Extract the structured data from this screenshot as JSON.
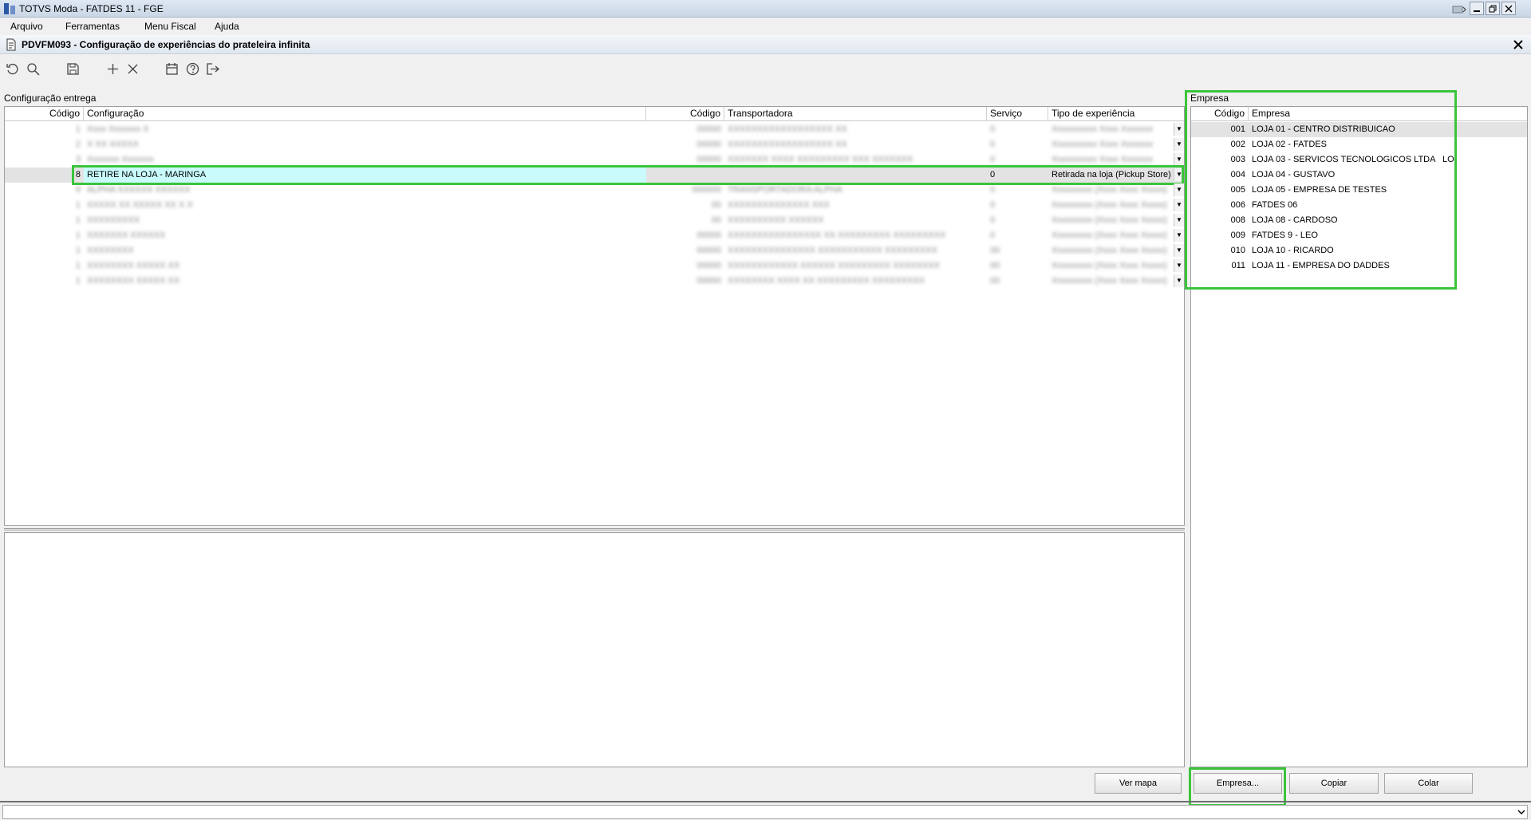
{
  "window": {
    "title": "TOTVS Moda - FATDES 11 - FGE"
  },
  "menu": [
    {
      "label": "Arquivo"
    },
    {
      "label": "Ferramentas"
    },
    {
      "label": "Menu Fiscal"
    },
    {
      "label": "Ajuda"
    }
  ],
  "form": {
    "title": "PDVFM093 - Configuração de experiências do prateleira infinita"
  },
  "toolbar": {
    "icons": [
      "refresh-icon",
      "search-icon",
      "save-icon",
      "add-icon",
      "delete-icon",
      "calendar-icon",
      "help-icon",
      "exit-icon"
    ]
  },
  "config": {
    "section_label": "Configuração entrega",
    "headers": {
      "codigo": "Código",
      "configuracao": "Configuração",
      "codigo2": "Código",
      "transportadora": "Transportadora",
      "servico": "Serviço",
      "tipo": "Tipo de experiência"
    },
    "rows": [
      {
        "codigo": "1",
        "configuracao": "Xxxx Xxxxxxx X",
        "codigo2": "00000",
        "transportadora": "XXXXXXXXXXXXXXXXXX XX",
        "servico": "0",
        "tipo": "Xxxxxxxxxx Xxxx Xxxxxxx",
        "blurred": true,
        "selected": false
      },
      {
        "codigo": "2",
        "configuracao": "X XX XXXXX",
        "codigo2": "00000",
        "transportadora": "XXXXXXXXXXXXXXXXXX XX",
        "servico": "0",
        "tipo": "Xxxxxxxxxx Xxxx Xxxxxxx",
        "blurred": true,
        "selected": false
      },
      {
        "codigo": "3",
        "configuracao": "Xxxxxxx Xxxxxxx",
        "codigo2": "00000",
        "transportadora": "XXXXXXX XXXX XXXXXXXXX XXX XXXXXXX",
        "servico": "0",
        "tipo": "Xxxxxxxxxx Xxxx Xxxxxxx",
        "blurred": true,
        "selected": false
      },
      {
        "codigo": "8",
        "configuracao": "RETIRE NA LOJA - MARINGA",
        "codigo2": "",
        "transportadora": "",
        "servico": "0",
        "tipo": "Retirada na loja (Pickup Store)",
        "blurred": false,
        "selected": true
      },
      {
        "codigo": "9",
        "configuracao": "ALPHA XXXXXX XXXXXX",
        "codigo2": "000000",
        "transportadora": "TRANSPORTADORA ALPHA",
        "servico": "0",
        "tipo": "Xxxxxxxxx (Xxxx Xxxx Xxxxx)",
        "blurred": true,
        "selected": false
      },
      {
        "codigo": "1",
        "configuracao": "XXXXX XX XXXXX XX X X",
        "codigo2": "00",
        "transportadora": "XXXXXXXXXXXXXX XXX",
        "servico": "0",
        "tipo": "Xxxxxxxxx (Xxxx Xxxx Xxxxx)",
        "blurred": true,
        "selected": false
      },
      {
        "codigo": "1",
        "configuracao": "XXXXXXXXX",
        "codigo2": "00",
        "transportadora": "XXXXXXXXXX XXXXXX",
        "servico": "0",
        "tipo": "Xxxxxxxxx (Xxxx Xxxx Xxxxx)",
        "blurred": true,
        "selected": false
      },
      {
        "codigo": "1",
        "configuracao": "XXXXXXX XXXXXX",
        "codigo2": "00000",
        "transportadora": "XXXXXXXXXXXXXXXX XX XXXXXXXXX XXXXXXXXX",
        "servico": "0",
        "tipo": "Xxxxxxxxx (Xxxx Xxxx Xxxxx)",
        "blurred": true,
        "selected": false
      },
      {
        "codigo": "1",
        "configuracao": "XXXXXXXX",
        "codigo2": "00000",
        "transportadora": "XXXXXXXXXXXXXXX XXXXXXXXXXX XXXXXXXXX",
        "servico": "00",
        "tipo": "Xxxxxxxxx (Xxxx Xxxx Xxxxx)",
        "blurred": true,
        "selected": false
      },
      {
        "codigo": "1",
        "configuracao": "XXXXXXXX XXXXX XX",
        "codigo2": "00000",
        "transportadora": "XXXXXXXXXXXX XXXXXX XXXXXXXXX XXXXXXXX",
        "servico": "00",
        "tipo": "Xxxxxxxxx (Xxxx Xxxx Xxxxx)",
        "blurred": true,
        "selected": false
      },
      {
        "codigo": "1",
        "configuracao": "XXXXXXXX XXXXX XX",
        "codigo2": "00000",
        "transportadora": "XXXXXXXX XXXX XX XXXXXXXXX XXXXXXXXX",
        "servico": "00",
        "tipo": "Xxxxxxxxx (Xxxx Xxxx Xxxxx)",
        "blurred": true,
        "selected": false
      }
    ]
  },
  "empresa": {
    "section_label": "Empresa",
    "headers": {
      "codigo": "Código",
      "empresa": "Empresa"
    },
    "rows": [
      {
        "codigo": "001",
        "empresa": "LOJA 01 - CENTRO DISTRIBUICAO"
      },
      {
        "codigo": "002",
        "empresa": "LOJA 02 - FATDES"
      },
      {
        "codigo": "003",
        "empresa": "LOJA 03 - SERVICOS TECNOLOGICOS LTDA   LO"
      },
      {
        "codigo": "004",
        "empresa": "LOJA 04 - GUSTAVO"
      },
      {
        "codigo": "005",
        "empresa": "LOJA 05 - EMPRESA DE TESTES"
      },
      {
        "codigo": "006",
        "empresa": "FATDES 06"
      },
      {
        "codigo": "008",
        "empresa": "LOJA 08 - CARDOSO"
      },
      {
        "codigo": "009",
        "empresa": "FATDES 9 - LEO"
      },
      {
        "codigo": "010",
        "empresa": "LOJA 10 - RICARDO"
      },
      {
        "codigo": "011",
        "empresa": "LOJA 11 - EMPRESA DO DADDES"
      }
    ]
  },
  "buttons": {
    "ver_mapa": "Ver mapa",
    "empresa": "Empresa...",
    "copiar": "Copiar",
    "colar": "Colar"
  },
  "colors": {
    "selected_row": "#c9fbfd",
    "highlight": "#3bc43b",
    "row_select_grey": "#e3e3e3"
  }
}
